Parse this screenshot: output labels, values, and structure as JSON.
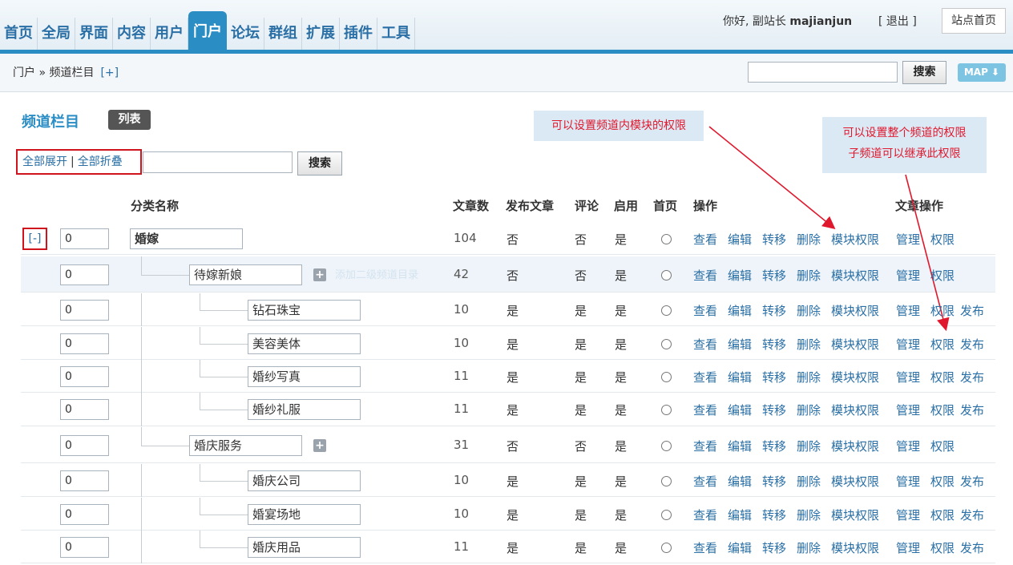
{
  "nav": {
    "items": [
      "首页",
      "全局",
      "界面",
      "内容",
      "用户",
      "门户",
      "论坛",
      "群组",
      "扩展",
      "插件",
      "工具"
    ],
    "active": "门户"
  },
  "header": {
    "greeting_prefix": "你好, 副站长 ",
    "username": "majianjun",
    "logout": "[ 退出 ]",
    "site_home": "站点首页"
  },
  "breadcrumb": {
    "text": "门户 » 频道栏目",
    "add": "[+]"
  },
  "top_search": {
    "value": "",
    "button": "搜索",
    "map_button": "MAP ⬇"
  },
  "page": {
    "title": "频道栏目",
    "list_tab": "列表"
  },
  "annotations": {
    "note1": "可以设置频道内模块的权限",
    "note2_line1": "可以设置整个频道的权限",
    "note2_line2": "子频道可以继承此权限"
  },
  "controls": {
    "expand_all": "全部展开",
    "separator": "|",
    "collapse_all": "全部折叠",
    "filter_value": "",
    "filter_button": "搜索",
    "collapse_row": "[-]"
  },
  "faint_label": "添加二级频道目录",
  "table": {
    "headers": {
      "name": "分类名称",
      "articles": "文章数",
      "publish": "发布文章",
      "comment": "评论",
      "enabled": "启用",
      "home": "首页",
      "ops": "操作",
      "ops2": "文章操作"
    },
    "actions": [
      "查看",
      "编辑",
      "转移",
      "删除",
      "模块权限"
    ],
    "rows": [
      {
        "level": 0,
        "order": "0",
        "name": "婚嫁",
        "articles": "104",
        "publish": "否",
        "comment": "否",
        "enabled": "是",
        "ops2": [
          "管理",
          "权限"
        ]
      },
      {
        "level": 1,
        "order": "0",
        "name": "待嫁新娘",
        "articles": "42",
        "publish": "否",
        "comment": "否",
        "enabled": "是",
        "ops2": [
          "管理",
          "权限"
        ]
      },
      {
        "level": 2,
        "order": "0",
        "name": "钻石珠宝",
        "articles": "10",
        "publish": "是",
        "comment": "是",
        "enabled": "是",
        "ops2": [
          "管理",
          "权限",
          "发布"
        ]
      },
      {
        "level": 2,
        "order": "0",
        "name": "美容美体",
        "articles": "10",
        "publish": "是",
        "comment": "是",
        "enabled": "是",
        "ops2": [
          "管理",
          "权限",
          "发布"
        ]
      },
      {
        "level": 2,
        "order": "0",
        "name": "婚纱写真",
        "articles": "11",
        "publish": "是",
        "comment": "是",
        "enabled": "是",
        "ops2": [
          "管理",
          "权限",
          "发布"
        ]
      },
      {
        "level": 2,
        "order": "0",
        "name": "婚纱礼服",
        "articles": "11",
        "publish": "是",
        "comment": "是",
        "enabled": "是",
        "ops2": [
          "管理",
          "权限",
          "发布"
        ]
      },
      {
        "level": 1,
        "order": "0",
        "name": "婚庆服务",
        "articles": "31",
        "publish": "否",
        "comment": "否",
        "enabled": "是",
        "ops2": [
          "管理",
          "权限"
        ]
      },
      {
        "level": 2,
        "order": "0",
        "name": "婚庆公司",
        "articles": "10",
        "publish": "是",
        "comment": "是",
        "enabled": "是",
        "ops2": [
          "管理",
          "权限",
          "发布"
        ]
      },
      {
        "level": 2,
        "order": "0",
        "name": "婚宴场地",
        "articles": "10",
        "publish": "是",
        "comment": "是",
        "enabled": "是",
        "ops2": [
          "管理",
          "权限",
          "发布"
        ]
      },
      {
        "level": 2,
        "order": "0",
        "name": "婚庆用品",
        "articles": "11",
        "publish": "是",
        "comment": "是",
        "enabled": "是",
        "ops2": [
          "管理",
          "权限",
          "发布"
        ]
      }
    ]
  },
  "colors": {
    "accent": "#2a8dc4",
    "link": "#2a6fa5",
    "annotation": "#e0182d",
    "highlight_box": "#d0141d"
  }
}
